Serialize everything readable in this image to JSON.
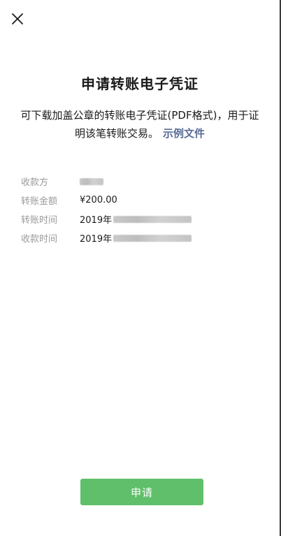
{
  "header": {
    "close_icon": "close-icon"
  },
  "page": {
    "title": "申请转账电子凭证",
    "description": "可下载加盖公章的转账电子凭证(PDF格式)，用于证明该笔转账交易。",
    "sample_link": "示例文件"
  },
  "details": [
    {
      "label": "收款方",
      "value": "",
      "redacted": "short"
    },
    {
      "label": "转账金额",
      "value": "¥200.00"
    },
    {
      "label": "转账时间",
      "value": "2019年",
      "redacted": "long"
    },
    {
      "label": "收款时间",
      "value": "2019年",
      "redacted": "long"
    }
  ],
  "actions": {
    "apply_label": "申请"
  },
  "colors": {
    "primary_green": "#5fbf6a",
    "link_blue": "#576b95",
    "label_gray": "#9a9a9a"
  }
}
